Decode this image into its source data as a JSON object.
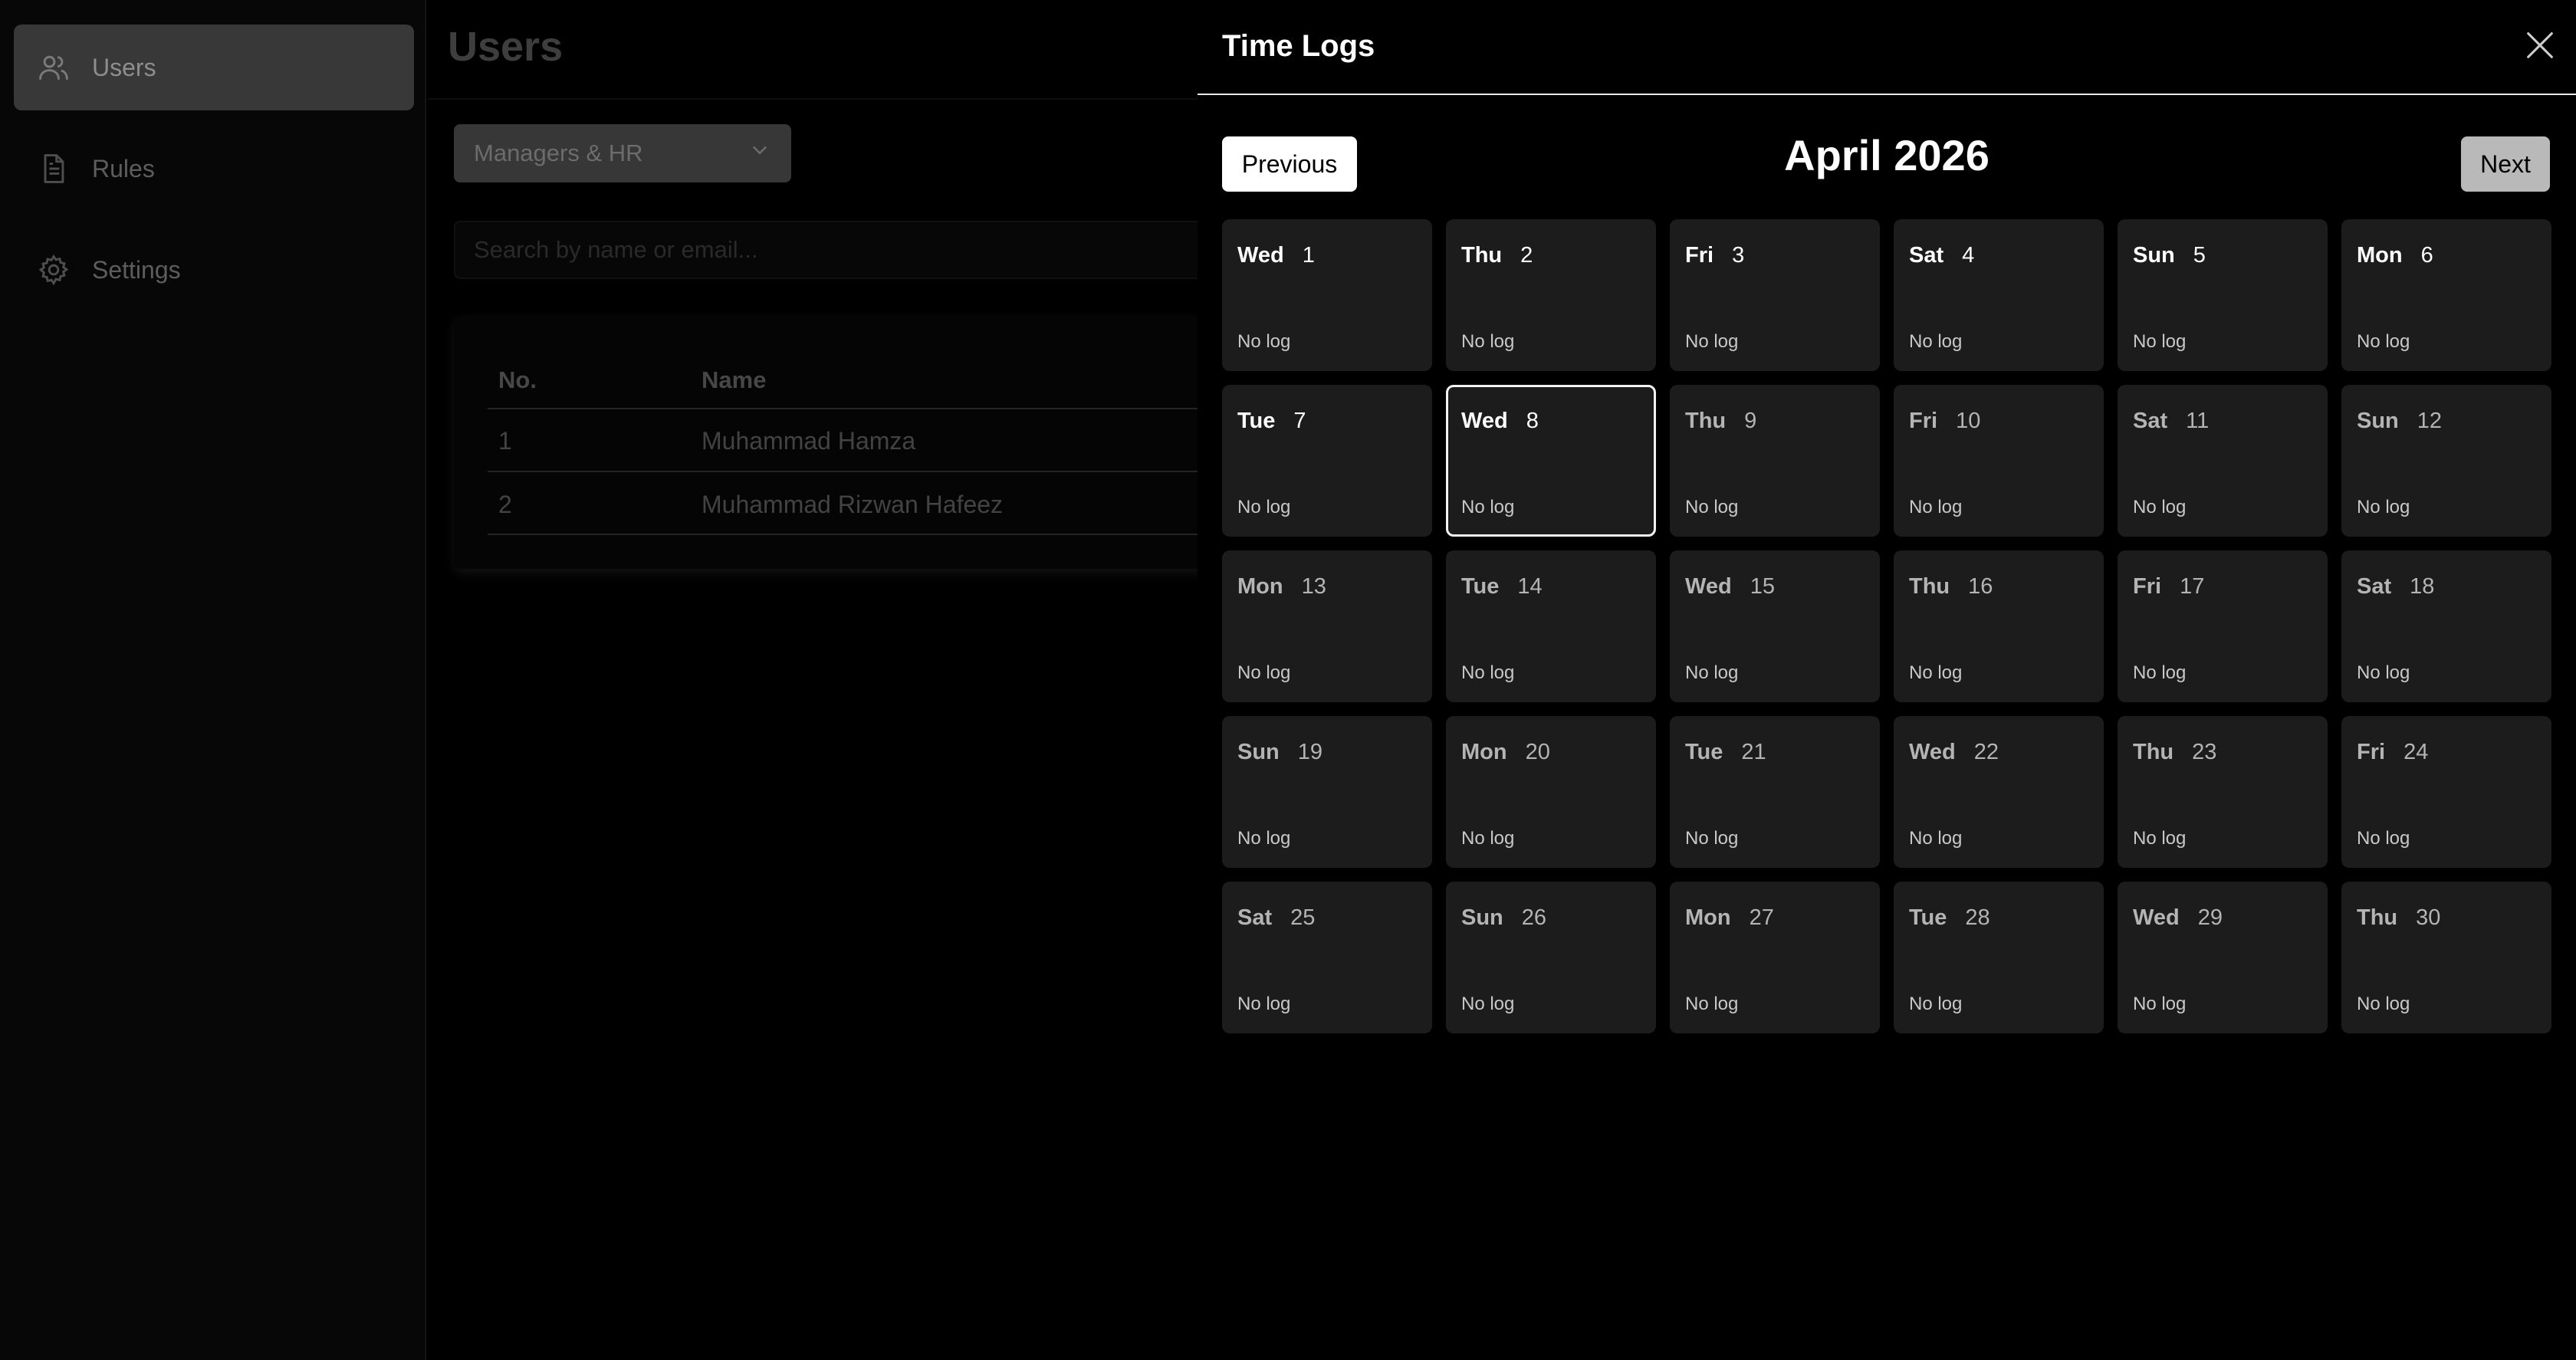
{
  "sidebar": {
    "items": [
      {
        "label": "Users",
        "icon": "users-icon",
        "active": true
      },
      {
        "label": "Rules",
        "icon": "document-icon",
        "active": false
      },
      {
        "label": "Settings",
        "icon": "gear-icon",
        "active": false
      }
    ]
  },
  "main": {
    "title": "Users",
    "role_filter": {
      "selected": "Managers & HR"
    },
    "search": {
      "placeholder": "Search by name or email..."
    },
    "table": {
      "columns": [
        "No.",
        "Name"
      ],
      "rows": [
        {
          "no": "1",
          "name": "Muhammad Hamza"
        },
        {
          "no": "2",
          "name": "Muhammad Rizwan Hafeez"
        }
      ]
    }
  },
  "drawer": {
    "title": "Time Logs",
    "prev_label": "Previous",
    "next_label": "Next",
    "month_title": "April 2026",
    "days": [
      {
        "dow": "Wed",
        "day": "1",
        "log": "No log"
      },
      {
        "dow": "Thu",
        "day": "2",
        "log": "No log"
      },
      {
        "dow": "Fri",
        "day": "3",
        "log": "No log"
      },
      {
        "dow": "Sat",
        "day": "4",
        "log": "No log"
      },
      {
        "dow": "Sun",
        "day": "5",
        "log": "No log"
      },
      {
        "dow": "Mon",
        "day": "6",
        "log": "No log"
      },
      {
        "dow": "Tue",
        "day": "7",
        "log": "No log"
      },
      {
        "dow": "Wed",
        "day": "8",
        "log": "No log",
        "selected": true
      },
      {
        "dow": "Thu",
        "day": "9",
        "log": "No log"
      },
      {
        "dow": "Fri",
        "day": "10",
        "log": "No log"
      },
      {
        "dow": "Sat",
        "day": "11",
        "log": "No log"
      },
      {
        "dow": "Sun",
        "day": "12",
        "log": "No log"
      },
      {
        "dow": "Mon",
        "day": "13",
        "log": "No log"
      },
      {
        "dow": "Tue",
        "day": "14",
        "log": "No log"
      },
      {
        "dow": "Wed",
        "day": "15",
        "log": "No log"
      },
      {
        "dow": "Thu",
        "day": "16",
        "log": "No log"
      },
      {
        "dow": "Fri",
        "day": "17",
        "log": "No log"
      },
      {
        "dow": "Sat",
        "day": "18",
        "log": "No log"
      },
      {
        "dow": "Sun",
        "day": "19",
        "log": "No log"
      },
      {
        "dow": "Mon",
        "day": "20",
        "log": "No log"
      },
      {
        "dow": "Tue",
        "day": "21",
        "log": "No log"
      },
      {
        "dow": "Wed",
        "day": "22",
        "log": "No log"
      },
      {
        "dow": "Thu",
        "day": "23",
        "log": "No log"
      },
      {
        "dow": "Fri",
        "day": "24",
        "log": "No log"
      },
      {
        "dow": "Sat",
        "day": "25",
        "log": "No log"
      },
      {
        "dow": "Sun",
        "day": "26",
        "log": "No log"
      },
      {
        "dow": "Mon",
        "day": "27",
        "log": "No log"
      },
      {
        "dow": "Tue",
        "day": "28",
        "log": "No log"
      },
      {
        "dow": "Wed",
        "day": "29",
        "log": "No log"
      },
      {
        "dow": "Thu",
        "day": "30",
        "log": "No log"
      }
    ]
  }
}
